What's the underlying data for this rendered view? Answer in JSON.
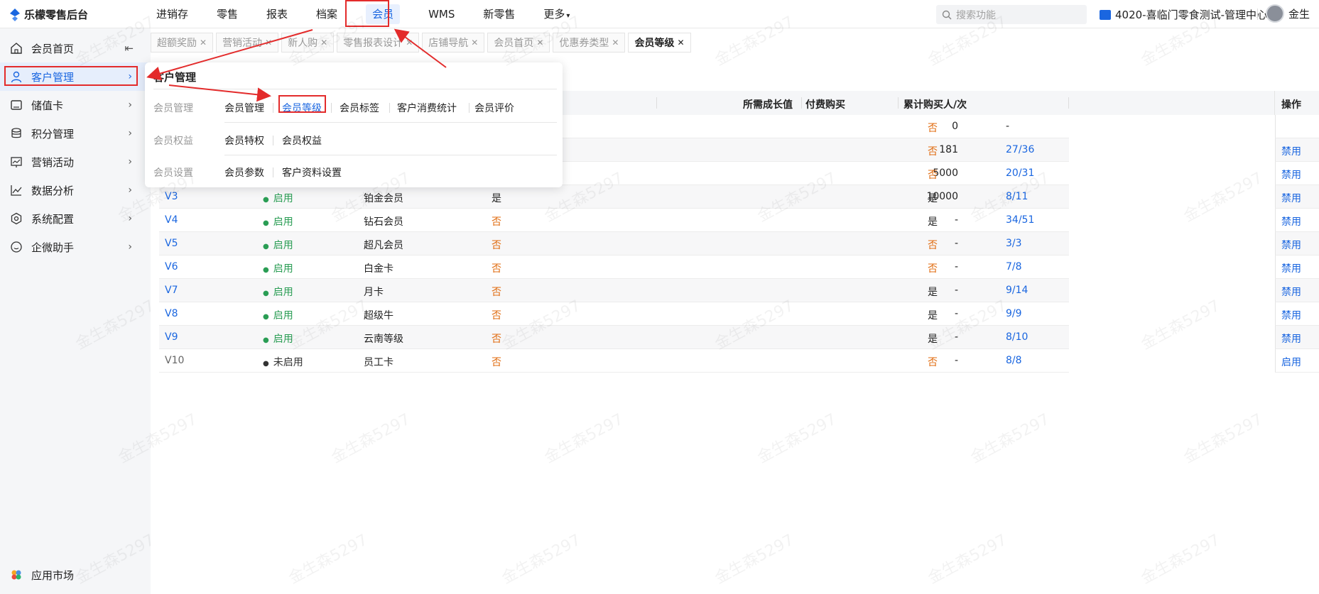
{
  "app": {
    "title": "乐檬零售后台"
  },
  "topnav": {
    "items": [
      {
        "label": "进销存"
      },
      {
        "label": "零售"
      },
      {
        "label": "报表"
      },
      {
        "label": "档案"
      },
      {
        "label": "会员"
      },
      {
        "label": "WMS"
      },
      {
        "label": "新零售"
      },
      {
        "label": "更多"
      }
    ],
    "active_index": 4
  },
  "search": {
    "placeholder": "搜索功能"
  },
  "store": {
    "label": "4020-喜临门零食测试-管理中心"
  },
  "user": {
    "name": "金生"
  },
  "sidebar": {
    "items": [
      {
        "label": "会员首页",
        "icon": "home-icon"
      },
      {
        "label": "客户管理",
        "icon": "user-icon"
      },
      {
        "label": "储值卡",
        "icon": "card-icon"
      },
      {
        "label": "积分管理",
        "icon": "database-icon"
      },
      {
        "label": "营销活动",
        "icon": "chart-board-icon"
      },
      {
        "label": "数据分析",
        "icon": "line-chart-icon"
      },
      {
        "label": "系统配置",
        "icon": "settings-icon"
      },
      {
        "label": "企微助手",
        "icon": "chat-icon"
      }
    ],
    "bottom": {
      "label": "应用市场",
      "icon": "app-market-icon"
    },
    "collapse_icon": "collapse-left-icon"
  },
  "tabs": [
    {
      "label": "超额奖励"
    },
    {
      "label": "营销活动"
    },
    {
      "label": "新人购"
    },
    {
      "label": "零售报表设计"
    },
    {
      "label": "店铺导航"
    },
    {
      "label": "会员首页"
    },
    {
      "label": "优惠券类型"
    },
    {
      "label": "会员等级"
    }
  ],
  "table": {
    "headers": {
      "grow": "所需成长值",
      "paid": "付费购买",
      "count": "累计购买人/次",
      "ops": "操作"
    },
    "rows": [
      {
        "code": "",
        "status": "",
        "name": "",
        "flag": "",
        "grow": "0",
        "paid": "否",
        "count": "-",
        "op": ""
      },
      {
        "code": "",
        "status": "",
        "name": "",
        "flag": "",
        "grow": "181",
        "paid": "否",
        "count": "27/36",
        "op": "禁用"
      },
      {
        "code": "",
        "status": "",
        "name": "",
        "flag": "",
        "grow": "5000",
        "paid": "否",
        "count": "20/31",
        "op": "禁用"
      },
      {
        "code": "V3",
        "status": "启用",
        "name": "铂金会员",
        "flag": "是",
        "grow": "10000",
        "paid": "是",
        "count": "8/11",
        "op": "禁用"
      },
      {
        "code": "V4",
        "status": "启用",
        "name": "钻石会员",
        "flag": "否",
        "grow": "-",
        "paid": "是",
        "count": "34/51",
        "op": "禁用"
      },
      {
        "code": "V5",
        "status": "启用",
        "name": "超凡会员",
        "flag": "否",
        "grow": "-",
        "paid": "否",
        "count": "3/3",
        "op": "禁用"
      },
      {
        "code": "V6",
        "status": "启用",
        "name": "白金卡",
        "flag": "否",
        "grow": "-",
        "paid": "否",
        "count": "7/8",
        "op": "禁用"
      },
      {
        "code": "V7",
        "status": "启用",
        "name": "月卡",
        "flag": "否",
        "grow": "-",
        "paid": "是",
        "count": "9/14",
        "op": "禁用"
      },
      {
        "code": "V8",
        "status": "启用",
        "name": "超级牛",
        "flag": "否",
        "grow": "-",
        "paid": "是",
        "count": "9/9",
        "op": "禁用"
      },
      {
        "code": "V9",
        "status": "启用",
        "name": "云南等级",
        "flag": "否",
        "grow": "-",
        "paid": "是",
        "count": "8/10",
        "op": "禁用"
      },
      {
        "code": "V10",
        "status": "未启用",
        "name": "员工卡",
        "flag": "否",
        "grow": "-",
        "paid": "否",
        "count": "8/8",
        "op": "启用"
      }
    ]
  },
  "menu_panel": {
    "title": "客户管理",
    "groups": [
      {
        "label": "会员管理",
        "links": [
          "会员管理",
          "会员等级",
          "会员标签",
          "客户消费统计",
          "会员评价"
        ]
      },
      {
        "label": "会员权益",
        "links": [
          "会员特权",
          "会员权益"
        ]
      },
      {
        "label": "会员设置",
        "links": [
          "会员参数",
          "客户资料设置"
        ]
      }
    ],
    "active_link": "会员等级"
  },
  "watermark": {
    "text": "金生森5297"
  },
  "colors": {
    "primary": "#1a66e0",
    "annotation": "#e32b2b",
    "warn": "#e06b0f",
    "success": "#2a9d54"
  }
}
